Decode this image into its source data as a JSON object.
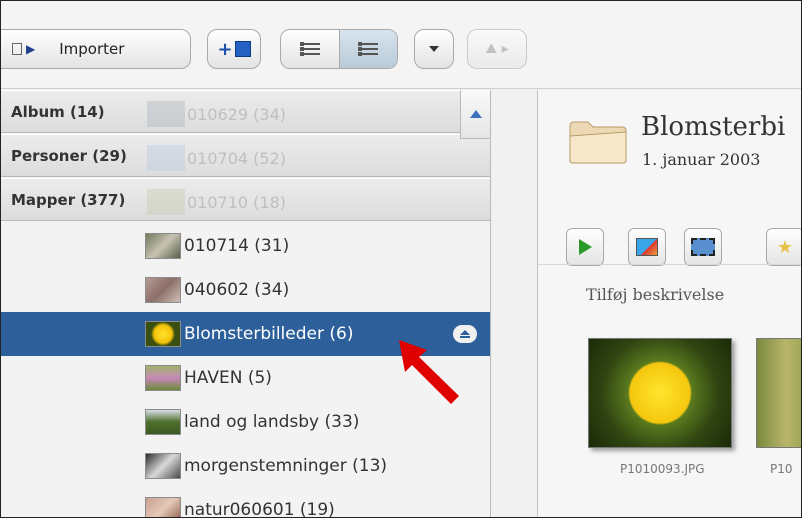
{
  "toolbar": {
    "import_label": "Importer"
  },
  "tree": {
    "headers": [
      {
        "label": "Album (14)",
        "ghost": "010629 (34)"
      },
      {
        "label": "Personer (29)",
        "ghost": "010704 (52)"
      },
      {
        "label": "Mapper (377)",
        "ghost": "010710 (18)"
      }
    ],
    "items": [
      {
        "label": "010714 (31)"
      },
      {
        "label": "040602 (34)"
      },
      {
        "label": "Blomsterbilleder (6)",
        "selected": true
      },
      {
        "label": "HAVEN (5)"
      },
      {
        "label": "land og landsby (33)"
      },
      {
        "label": "morgenstemninger (13)"
      },
      {
        "label": "natur060601 (19)"
      }
    ]
  },
  "event": {
    "title": "Blomsterbi",
    "date": "1. januar 2003",
    "description_placeholder": "Tilføj beskrivelse",
    "photos": [
      {
        "filename": "P1010093.JPG"
      },
      {
        "filename": "P10"
      }
    ]
  },
  "colors": {
    "selected_row": "#2d5f9a",
    "arrow": "#e00000"
  }
}
